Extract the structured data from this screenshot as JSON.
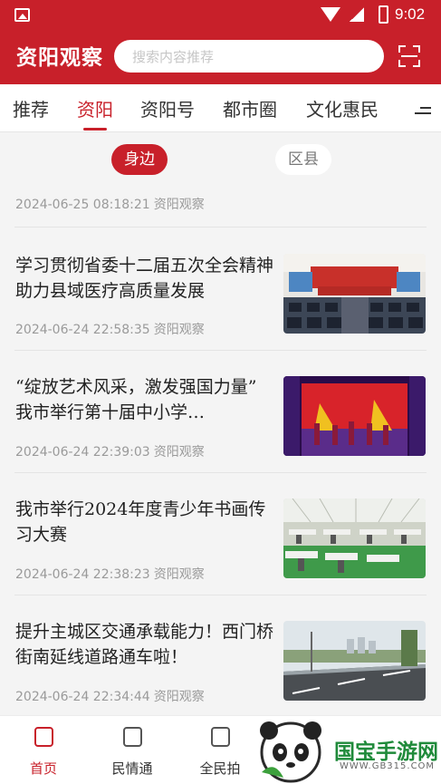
{
  "status_bar": {
    "time": "9:02"
  },
  "header": {
    "logo": "资阳观察",
    "search_placeholder": "搜索内容推荐",
    "scan_icon": "scan-icon"
  },
  "tabs": [
    "推荐",
    "资阳",
    "资阳号",
    "都市圈",
    "文化惠民"
  ],
  "active_tab": "资阳",
  "filters": {
    "nearby": "身边",
    "county": "区县"
  },
  "first_meta": {
    "date": "2024-06-25 08:18:21",
    "source": "资阳观察"
  },
  "articles": [
    {
      "title": "学习贯彻省委十二届五次全会精神 助力县域医疗高质量发展",
      "date": "2024-06-24 22:58:35",
      "source": "资阳观察"
    },
    {
      "title": "“绽放艺术风采，激发强国力量” 我市举行第十届中小学…",
      "date": "2024-06-24 22:39:03",
      "source": "资阳观察"
    },
    {
      "title": "我市举行2024年度青少年书画传习大赛",
      "date": "2024-06-24 22:38:23",
      "source": "资阳观察"
    },
    {
      "title": "提升主城区交通承载能力！西门桥街南延线道路通车啦！",
      "date": "2024-06-24 22:34:44",
      "source": "资阳观察"
    }
  ],
  "bottom_nav": [
    "首页",
    "民情通",
    "全民拍"
  ],
  "watermark": {
    "brand": "国宝手游网",
    "url": "WWW.GB315.COM"
  },
  "colors": {
    "accent": "#c8202a"
  }
}
